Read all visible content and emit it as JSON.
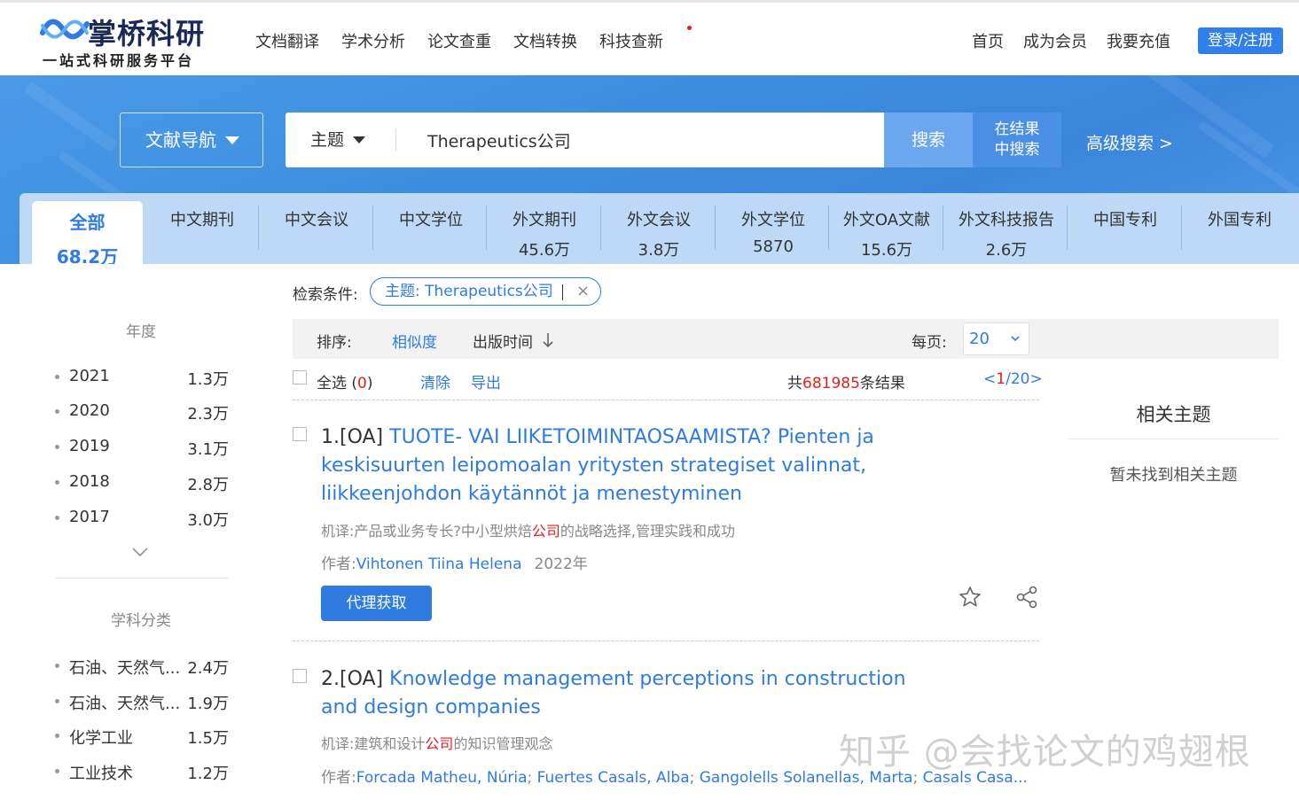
{
  "header": {
    "logo_name": "掌桥科研",
    "logo_slogan": "一站式科研服务平台",
    "nav": [
      "文档翻译",
      "学术分析",
      "论文查重",
      "文档转换",
      "科技查新"
    ],
    "right_nav": [
      "首页",
      "成为会员",
      "我要充值"
    ],
    "login_label": "登录/注册"
  },
  "search": {
    "nav_dropdown": "文献导航",
    "scope": "主题",
    "query": "Therapeutics公司",
    "search_label": "搜索",
    "in_results_line1": "在结果",
    "in_results_line2": "中搜索",
    "advanced_label": "高级搜索 >"
  },
  "tabs": [
    {
      "name": "全部",
      "count": "68.2万"
    },
    {
      "name": "中文期刊",
      "count": ""
    },
    {
      "name": "中文会议",
      "count": ""
    },
    {
      "name": "中文学位",
      "count": ""
    },
    {
      "name": "外文期刊",
      "count": "45.6万"
    },
    {
      "name": "外文会议",
      "count": "3.8万"
    },
    {
      "name": "外文学位",
      "count": "5870"
    },
    {
      "name": "外文OA文献",
      "count": "15.6万"
    },
    {
      "name": "外文科技报告",
      "count": "2.6万"
    },
    {
      "name": "中国专利",
      "count": ""
    },
    {
      "name": "外国专利",
      "count": ""
    }
  ],
  "sidebar": {
    "year_title": "年度",
    "years": [
      {
        "label": "2021",
        "count": "1.3万"
      },
      {
        "label": "2020",
        "count": "2.3万"
      },
      {
        "label": "2019",
        "count": "3.1万"
      },
      {
        "label": "2018",
        "count": "2.8万"
      },
      {
        "label": "2017",
        "count": "3.0万"
      }
    ],
    "subject_title": "学科分类",
    "subjects": [
      {
        "label": "石油、天然气...",
        "count": "2.4万"
      },
      {
        "label": "石油、天然气...",
        "count": "1.9万"
      },
      {
        "label": "化学工业",
        "count": "1.5万"
      },
      {
        "label": "工业技术",
        "count": "1.2万"
      }
    ]
  },
  "conditions": {
    "label": "检索条件:",
    "chip": "主题: Therapeutics公司"
  },
  "sortbar": {
    "label": "排序:",
    "relevance": "相似度",
    "date": "出版时间",
    "per_page_label": "每页:",
    "per_page_value": "20"
  },
  "toolbar": {
    "select_all": "全选",
    "selected_count": "0",
    "clear": "清除",
    "export": "导出",
    "total_prefix": "共",
    "total_count": "681985",
    "total_suffix": "条结果",
    "page_current": "1",
    "page_total": "20"
  },
  "results": [
    {
      "num": "1.[OA]",
      "title": "TUOTE- VAI LIIKETOIMINTAOSAAMISTA? Pienten ja keskisuurten leipomoalan yritysten strategiset valinnat, liikkeenjohdon käytännöt ja menestyminen",
      "mt_label": "机译:",
      "mt_before": "产品或业务专长?中小型烘焙",
      "mt_highlight": "公司",
      "mt_after": "的战略选择,管理实践和成功",
      "author_label": "作者:",
      "authors": [
        "Vihtonen Tiina Helena"
      ],
      "year": "2022年",
      "button": "代理获取"
    },
    {
      "num": "2.[OA]",
      "title": "Knowledge management perceptions in construction and design companies",
      "mt_label": "机译:",
      "mt_before": "建筑和设计",
      "mt_highlight": "公司",
      "mt_after": "的知识管理观念",
      "author_label": "作者:",
      "authors": [
        "Forcada Matheu, Núria",
        "Fuertes Casals, Alba",
        "Gangolells Solanellas, Marta",
        "Casals Casa..."
      ]
    }
  ],
  "related": {
    "title": "相关主题",
    "empty": "暂未找到相关主题"
  },
  "watermark": "知乎 @会找论文的鸡翅根",
  "colors": {
    "accent": "#2f7be0",
    "banner": "#3d8ee0",
    "highlight_red": "#e02020"
  }
}
